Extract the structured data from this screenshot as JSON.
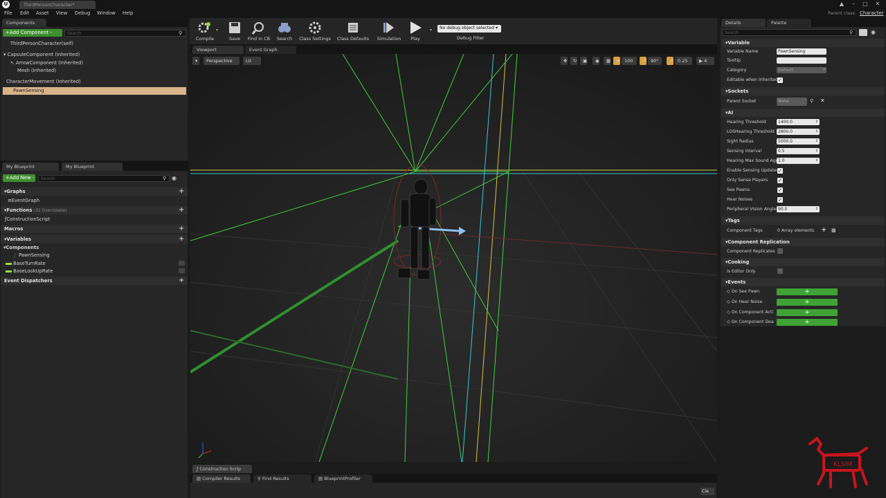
{
  "window": {
    "doc_tab": "ThirdPersonCharacter*",
    "parent_class_label": "Parent class:",
    "parent_class_value": "Character"
  },
  "menu": [
    "File",
    "Edit",
    "Asset",
    "View",
    "Debug",
    "Window",
    "Help"
  ],
  "components_panel": {
    "tab": "Components",
    "add_button": "+Add Component -",
    "search_placeholder": "Search",
    "root": "ThirdPersonCharacter(self)",
    "items": [
      "CapsuleComponent (Inherited)",
      "ArrowComponent (Inherited)",
      "Mesh (Inherited)",
      "CharacterMovement (Inherited)",
      "PawnSensing"
    ]
  },
  "my_blueprint": {
    "tabs": [
      "My Blueprint",
      "My Blueprint"
    ],
    "add_button": "+Add New -",
    "search_placeholder": "Search",
    "graphs_label": "Graphs",
    "graph_items": [
      "EventGraph"
    ],
    "functions_label": "Functions",
    "functions_count": "(32 Overridable)",
    "function_items": [
      "ConstructionScript"
    ],
    "macros_label": "Macros",
    "variables_label": "Variables",
    "components_label": "Components",
    "component_vars": [
      "PawnSensing"
    ],
    "vars": [
      "BaseTurnRate",
      "BaseLookUpRate"
    ],
    "dispatchers_label": "Event Dispatchers"
  },
  "toolbar": {
    "buttons": [
      "Compile",
      "Save",
      "Find in CB",
      "Search",
      "Class Settings",
      "Class Defaults",
      "Simulation",
      "Play"
    ],
    "debug_dropdown": "No debug object selected ▾",
    "debug_filter": "Debug Filter"
  },
  "viewport": {
    "tabs": [
      "Viewport",
      "Event Graph"
    ],
    "perspective": "Perspective",
    "lit": "Lit",
    "grid_size": "100",
    "rot_snap": "90°",
    "scale_snap": "0.25",
    "cam_speed": "4"
  },
  "bottom": {
    "tab_construction": "Construction Scrip",
    "tabs": [
      "Compiler Results",
      "Find Results",
      "BlueprintProfiler"
    ],
    "clear": "Cle"
  },
  "details": {
    "tabs": [
      "Details",
      "Palette"
    ],
    "search_placeholder": "Search",
    "variable_section": "Variable",
    "variable_name_label": "Variable Name",
    "variable_name_value": "PawnSensing",
    "tooltip_label": "Tooltip",
    "category_label": "Category",
    "category_value": "Default",
    "editable_label": "Editable when Inherited",
    "sockets_section": "Sockets",
    "parent_socket_label": "Parent Socket",
    "parent_socket_value": "None",
    "ai_section": "AI",
    "ai_numeric": [
      {
        "label": "Hearing Threshold",
        "value": "1400.0"
      },
      {
        "label": "LOSHearing Threshold",
        "value": "2800.0"
      },
      {
        "label": "Sight Radius",
        "value": "5000.0"
      },
      {
        "label": "Sensing Interval",
        "value": "0.5"
      },
      {
        "label": "Hearing Max Sound Age",
        "value": "1.0"
      }
    ],
    "ai_checks": [
      "Enable Sensing Updates",
      "Only Sense Players",
      "See Pawns",
      "Hear Noises"
    ],
    "peripheral_label": "Peripheral Vision Angle",
    "peripheral_value": "90.0",
    "tags_section": "Tags",
    "component_tags_label": "Component Tags",
    "component_tags_value": "0 Array elements",
    "replication_section": "Component Replication",
    "replicates_label": "Component Replicates",
    "cooking_section": "Cooking",
    "editor_only_label": "Is Editor Only",
    "events_section": "Events",
    "events": [
      "On See Pawn",
      "On Hear Noise",
      "On Component Acti",
      "On Component Dea"
    ]
  },
  "watermark": "KLSIM",
  "colors": {
    "accent_green": "#3e8f2e",
    "event_green": "#3fa235",
    "selection": "#d9b48a"
  }
}
